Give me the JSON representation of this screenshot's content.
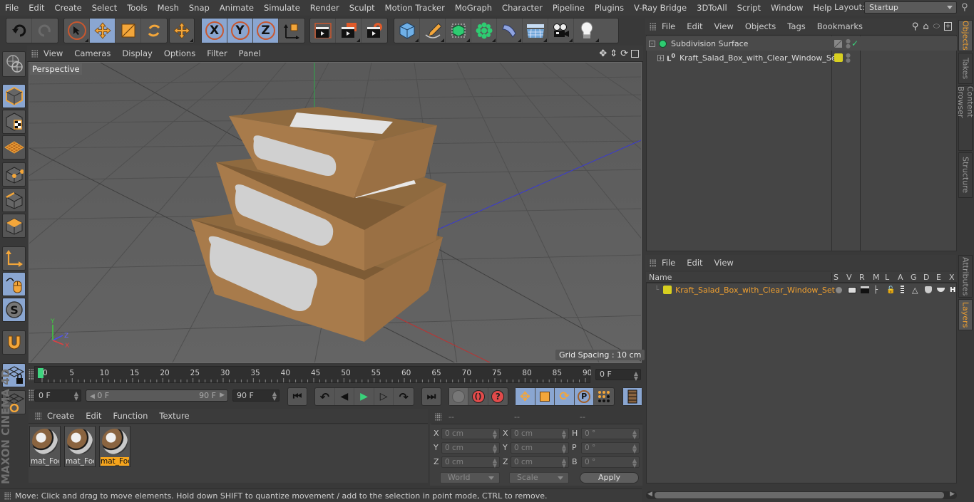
{
  "menubar": {
    "items": [
      "File",
      "Edit",
      "Create",
      "Select",
      "Tools",
      "Mesh",
      "Snap",
      "Animate",
      "Simulate",
      "Render",
      "Sculpt",
      "Motion Tracker",
      "MoGraph",
      "Character",
      "Pipeline",
      "Plugins",
      "V-Ray Bridge",
      "3DToAll",
      "Script",
      "Window",
      "Help"
    ],
    "layout_label": "Layout:",
    "layout_value": "Startup"
  },
  "toolbar": {
    "undo": "undo-icon",
    "redo": "redo-icon",
    "axis_x": "X",
    "axis_y": "Y",
    "axis_z": "Z"
  },
  "viewport": {
    "menu": [
      "View",
      "Cameras",
      "Display",
      "Options",
      "Filter",
      "Panel"
    ],
    "label": "Perspective",
    "grid_spacing": "Grid Spacing : 10 cm",
    "axis_labels": {
      "x": "X",
      "y": "Y",
      "z": "Z"
    }
  },
  "timeline": {
    "ticks": [
      "0",
      "5",
      "10",
      "15",
      "20",
      "25",
      "30",
      "35",
      "40",
      "45",
      "50",
      "55",
      "60",
      "65",
      "70",
      "75",
      "80",
      "85",
      "90"
    ],
    "current_frame": "0 F",
    "start_field": "0 F",
    "range_start": "0 F",
    "range_end": "90 F",
    "end_field": "90 F",
    "current_position": 0,
    "max_frame": 90
  },
  "materials": {
    "menu": [
      "Create",
      "Edit",
      "Function",
      "Texture"
    ],
    "items": [
      {
        "name": "mat_Foc",
        "selected": false
      },
      {
        "name": "mat_Foc",
        "selected": false
      },
      {
        "name": "mat_Foc",
        "selected": true
      }
    ]
  },
  "coordinates": {
    "headers": [
      "--",
      "--",
      "--"
    ],
    "position": [
      {
        "axis": "X",
        "value": "0 cm"
      },
      {
        "axis": "Y",
        "value": "0 cm"
      },
      {
        "axis": "Z",
        "value": "0 cm"
      }
    ],
    "size": [
      {
        "axis": "X",
        "value": "0 cm"
      },
      {
        "axis": "Y",
        "value": "0 cm"
      },
      {
        "axis": "Z",
        "value": "0 cm"
      }
    ],
    "rotation": [
      {
        "axis": "H",
        "value": "0 °"
      },
      {
        "axis": "P",
        "value": "0 °"
      },
      {
        "axis": "B",
        "value": "0 °"
      }
    ],
    "space": "World",
    "mode": "Scale",
    "apply": "Apply"
  },
  "status": {
    "text": "Move: Click and drag to move elements. Hold down SHIFT to quantize movement / add to the selection in point mode, CTRL to remove."
  },
  "object_manager": {
    "menu": [
      "File",
      "Edit",
      "View",
      "Objects",
      "Tags",
      "Bookmarks"
    ],
    "objects": [
      {
        "name": "Subdivision Surface",
        "expanded": true
      },
      {
        "name": "Kraft_Salad_Box_with_Clear_Window_Set",
        "expanded": false,
        "layer_color": "#d8d020"
      }
    ]
  },
  "layer_manager": {
    "menu": [
      "File",
      "Edit",
      "View"
    ],
    "columns": [
      "Name",
      "S",
      "V",
      "R",
      "M",
      "L",
      "A",
      "G",
      "D",
      "E",
      "X"
    ],
    "layers": [
      {
        "name": "Kraft_Salad_Box_with_Clear_Window_Set",
        "color": "#d8d020"
      }
    ]
  },
  "side_tabs": {
    "top": [
      {
        "label": "Objects",
        "active": true
      },
      {
        "label": "Takes",
        "active": false
      },
      {
        "label": "Content Browser",
        "active": false
      },
      {
        "label": "Structure",
        "active": false
      }
    ],
    "bottom": [
      {
        "label": "Attributes",
        "active": false
      },
      {
        "label": "Layers",
        "active": true
      }
    ]
  },
  "branding": {
    "logo": "MAXON CINEMA 4D"
  },
  "colors": {
    "accent": "#8aa6d1",
    "selection": "#f7a51c",
    "layer": "#d8d020",
    "box": "#a87b4b"
  }
}
